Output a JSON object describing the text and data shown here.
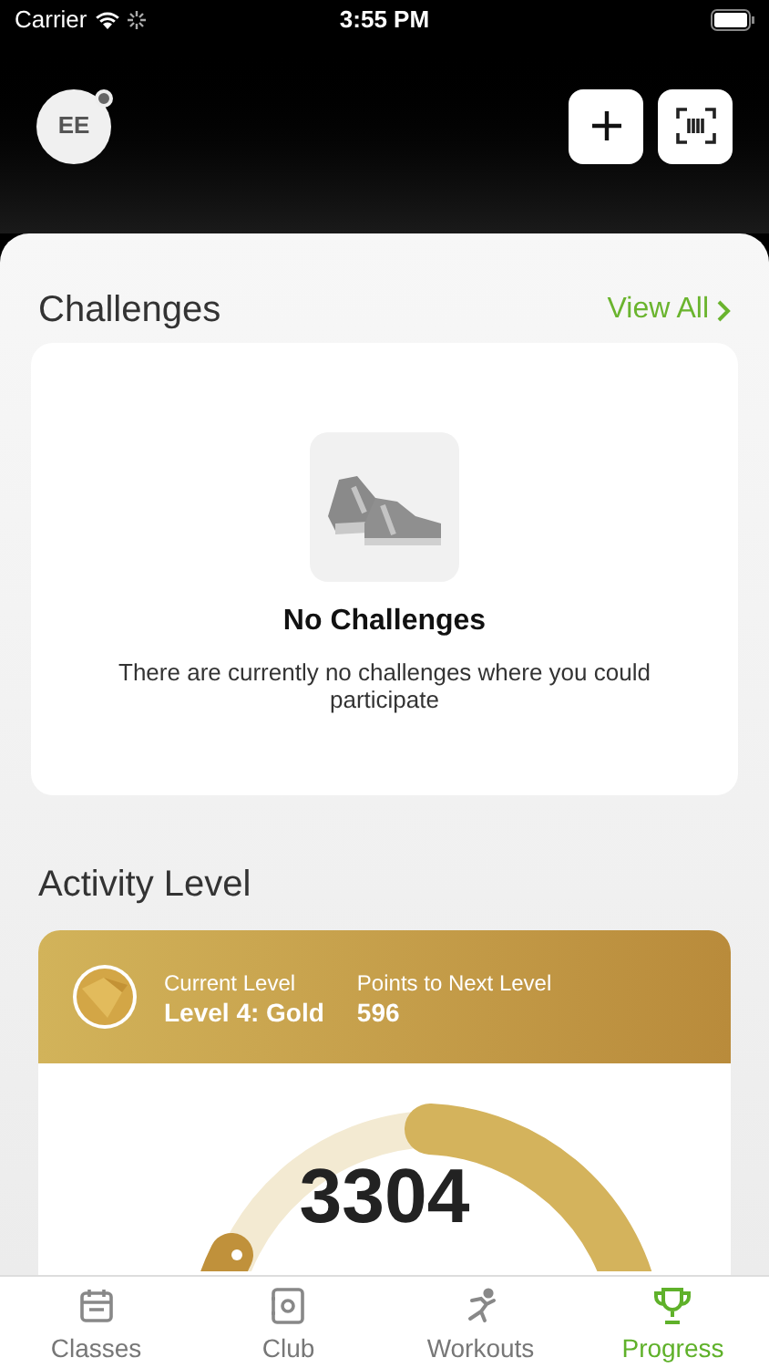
{
  "status_bar": {
    "carrier": "Carrier",
    "time": "3:55 PM"
  },
  "header": {
    "avatar_initials": "EE"
  },
  "challenges": {
    "title": "Challenges",
    "view_all": "View All",
    "empty_title": "No Challenges",
    "empty_text": "There are currently no challenges where you could participate"
  },
  "activity": {
    "title": "Activity Level",
    "current_label": "Current Level",
    "current_value": "Level 4: Gold",
    "next_label": "Points to Next Level",
    "next_value": "596",
    "points": "3304"
  },
  "tabs": [
    {
      "label": "Classes",
      "selected": false
    },
    {
      "label": "Club",
      "selected": false
    },
    {
      "label": "Workouts",
      "selected": false
    },
    {
      "label": "Progress",
      "selected": true
    }
  ]
}
